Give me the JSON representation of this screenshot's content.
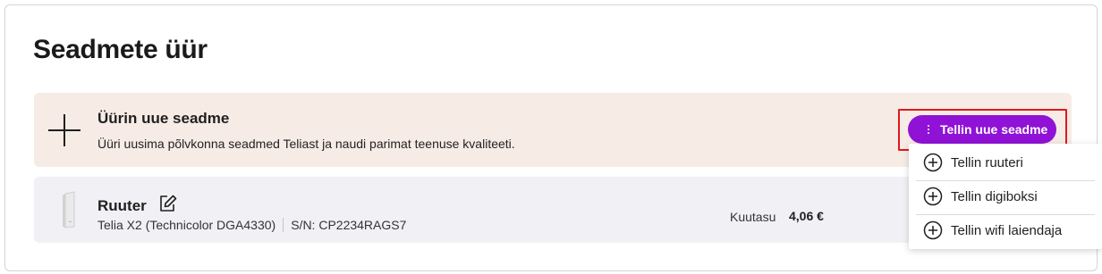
{
  "page": {
    "title": "Seadmete üür"
  },
  "promo": {
    "title": "Üürin uue seadme",
    "description": "Üüri uusima põlvkonna seadmed Teliast ja naudi parimat teenuse kvaliteeti.",
    "order_button_label": "Tellin uue seadme"
  },
  "dropdown": {
    "items": [
      {
        "label": "Tellin ruuteri",
        "icon": "plus-circle-icon"
      },
      {
        "label": "Tellin digiboksi",
        "icon": "plus-circle-icon"
      },
      {
        "label": "Tellin wifi laiendaja",
        "icon": "plus-circle-icon"
      }
    ]
  },
  "device": {
    "name": "Ruuter",
    "model": "Telia X2 (Technicolor DGA4330)",
    "serial": "S/N: CP2234RAGS7",
    "fee_label": "Kuutasu",
    "fee_value": "4,06 €",
    "icon": "router-icon",
    "edit_icon": "edit-icon"
  },
  "colors": {
    "accent": "#9012d6",
    "promo_bg": "#f7ebe5",
    "device_bg": "#f1f1f5",
    "highlight": "#e0191f"
  }
}
